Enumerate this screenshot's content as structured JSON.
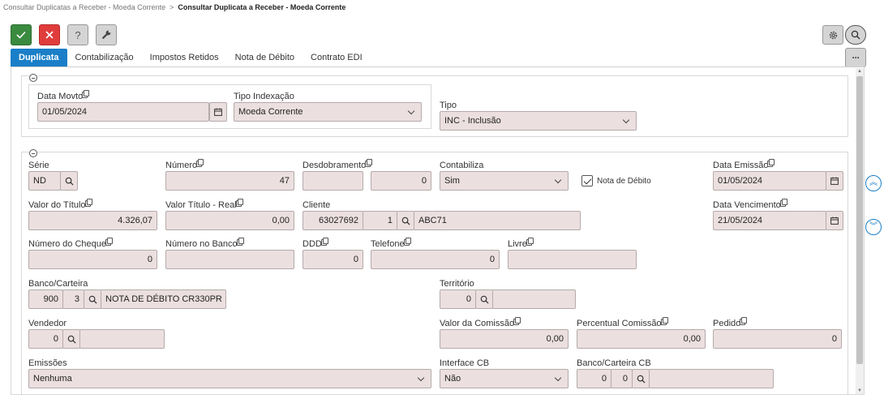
{
  "breadcrumb": {
    "parent": "Consultar Duplicatas a Receber - Moeda Corrente",
    "separator": ">",
    "current": "Consultar Duplicata a Receber - Moeda Corrente"
  },
  "toolbar": {
    "confirm_icon": "check-icon",
    "cancel_icon": "close-icon",
    "help_label": "?",
    "tools_icon": "wrench-icon",
    "settings_icon": "gear-icon",
    "search_icon": "search-icon",
    "more_label": "···"
  },
  "tabs": [
    {
      "label": "Duplicata",
      "active": true
    },
    {
      "label": "Contabilização",
      "active": false
    },
    {
      "label": "Impostos Retidos",
      "active": false
    },
    {
      "label": "Nota de Débito",
      "active": false
    },
    {
      "label": "Contrato EDI",
      "active": false
    }
  ],
  "section1": {
    "data_movto": {
      "label": "Data Movto",
      "value": "01/05/2024"
    },
    "tipo_indexacao": {
      "label": "Tipo Indexação",
      "value": "Moeda Corrente"
    },
    "tipo": {
      "label": "Tipo",
      "value": "INC - Inclusão"
    }
  },
  "section2": {
    "serie": {
      "label": "Série",
      "value": "ND"
    },
    "numero": {
      "label": "Número",
      "value": "47"
    },
    "desdobramento": {
      "label": "Desdobramento",
      "value1": "",
      "value2": "0"
    },
    "contabiliza": {
      "label": "Contabiliza",
      "value": "Sim"
    },
    "nota_debito": {
      "label": "Nota de Débito",
      "checked": true
    },
    "data_emissao": {
      "label": "Data Emissão",
      "value": "01/05/2024"
    },
    "valor_titulo": {
      "label": "Valor do Título",
      "value": "4.326,07"
    },
    "valor_titulo_real": {
      "label": "Valor Título - Real",
      "value": "0,00"
    },
    "cliente": {
      "label": "Cliente",
      "code": "63027692",
      "seq": "1",
      "name": "ABC71"
    },
    "data_vencimento": {
      "label": "Data Vencimento",
      "value": "21/05/2024"
    },
    "numero_cheque": {
      "label": "Número do Cheque",
      "value": "0"
    },
    "numero_banco": {
      "label": "Número no Banco",
      "value": ""
    },
    "ddd": {
      "label": "DDD",
      "value": "0"
    },
    "telefone": {
      "label": "Telefone",
      "value": "0"
    },
    "livre": {
      "label": "Livre",
      "value": ""
    },
    "banco_carteira": {
      "label": "Banco/Carteira",
      "banco": "900",
      "carteira": "3",
      "descricao": "NOTA DE DÉBITO CR330PR"
    },
    "territorio": {
      "label": "Território",
      "value": "0",
      "descricao": ""
    },
    "vendedor": {
      "label": "Vendedor",
      "value": "0",
      "descricao": ""
    },
    "valor_comissao": {
      "label": "Valor da Comissão",
      "value": "0,00"
    },
    "percentual_comissao": {
      "label": "Percentual Comissão",
      "value": "0,00"
    },
    "pedido": {
      "label": "Pedido",
      "value": "0"
    },
    "emissoes": {
      "label": "Emissões",
      "value": "Nenhuma"
    },
    "interface_cb": {
      "label": "Interface CB",
      "value": "Não"
    },
    "banco_carteira_cb": {
      "label": "Banco/Carteira CB",
      "banco": "0",
      "carteira": "0",
      "descricao": ""
    }
  },
  "side_buttons": {
    "up_label": "︽",
    "down_label": "︾"
  },
  "colors": {
    "accent": "#1a7fc8",
    "confirm": "#3a8a3f",
    "cancel": "#e03c3c",
    "field_bg": "#ecdfe0"
  }
}
